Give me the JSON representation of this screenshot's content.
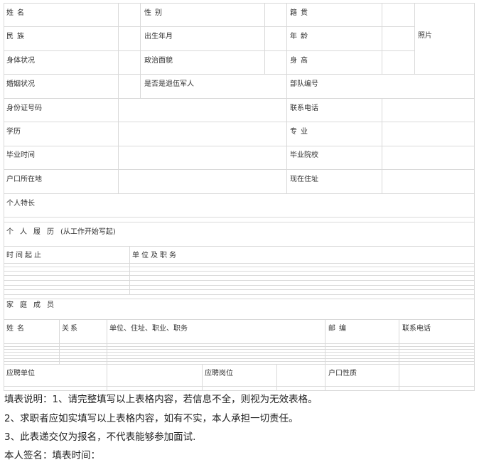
{
  "form": {
    "name_label": "姓名",
    "gender_label": "性别",
    "native_place_label": "籍贯",
    "photo_label": "照片",
    "ethnicity_label": "民族",
    "birth_label": "出生年月",
    "age_label": "年龄",
    "health_label": "身体状况",
    "political_label": "政治面貌",
    "height_label": "身高",
    "marital_label": "婚姻状况",
    "veteran_label": "是否是退伍军人",
    "unit_number_label": "部队编号",
    "id_label": "身份证号码",
    "phone_label": "联系电话",
    "education_label": "学历",
    "major_label": "专业",
    "grad_time_label": "毕业时间",
    "school_label": "毕业院校",
    "hukou_label": "户口所在地",
    "address_label": "现在住址",
    "skills_label": "个人特长",
    "resume_title": "个人履历",
    "resume_note": "(从工作开始写起)",
    "resume_period_header": "时间起止",
    "resume_unit_header": "单位及职务",
    "family_title": "家庭成员",
    "family_headers": [
      "姓名",
      "关系",
      "单位、住址、职业、职务",
      "邮编",
      "联系电话"
    ],
    "apply_unit_label": "应聘单位",
    "apply_post_label": "应聘岗位",
    "hukou_type_label": "户口性质"
  },
  "notes": {
    "line1": "填表说明：1、请完整填写以上表格内容，若信息不全，则视为无效表格。",
    "line2": "2、求职者应如实填写以上表格内容，如有不实，本人承担一切责任。",
    "line3": "3、此表递交仅为报名，不代表能够参加面试.",
    "line4": "本人签名：填表时间："
  }
}
